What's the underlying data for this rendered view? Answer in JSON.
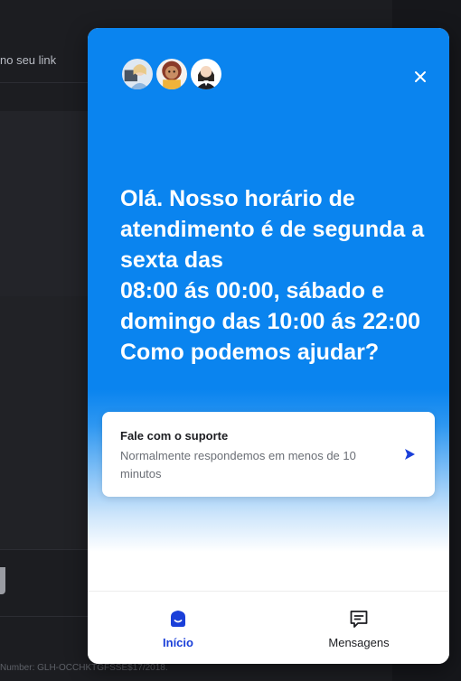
{
  "background": {
    "link_text": "no seu link",
    "footnote": "Number: GLH-OCCHKTGFSSE$17/2018."
  },
  "widget": {
    "avatars": [
      {
        "icon": "agent-avatar-icon-1"
      },
      {
        "icon": "agent-avatar-icon-2"
      },
      {
        "icon": "agent-avatar-icon-3"
      }
    ],
    "close_icon": "close-icon",
    "greeting": "Olá. Nosso horário de atendimento é de segunda a sexta das\n 08:00 ás 00:00, sábado e domingo das 10:00 ás 22:00\nComo podemos ajudar?",
    "support_card": {
      "title": "Fale com o suporte",
      "subtitle": "Normalmente respondemos em menos de 10 minutos",
      "arrow_icon": "send-arrow-icon"
    },
    "nav": {
      "home_label": "Início",
      "home_icon": "home-chat-icon",
      "messages_label": "Mensagens",
      "messages_icon": "messages-icon"
    },
    "colors": {
      "brand_blue": "#0a84ef",
      "active_nav": "#1a3fd9"
    }
  }
}
